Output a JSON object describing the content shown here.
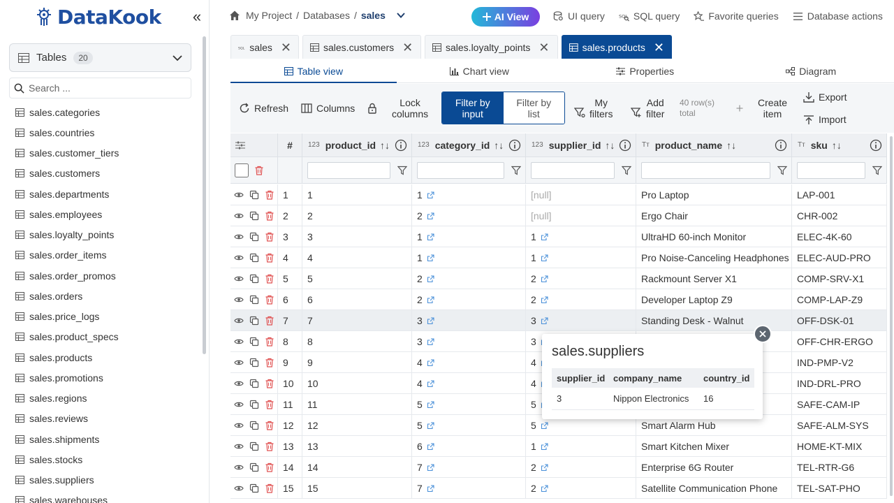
{
  "app": {
    "logo_text": "DataKook",
    "collapse_glyph": "«"
  },
  "sidebar": {
    "tables_label": "Tables",
    "tables_count": "20",
    "search_placeholder": "Search ...",
    "items": [
      "sales.categories",
      "sales.countries",
      "sales.customer_tiers",
      "sales.customers",
      "sales.departments",
      "sales.employees",
      "sales.loyalty_points",
      "sales.order_items",
      "sales.order_promos",
      "sales.orders",
      "sales.price_logs",
      "sales.product_specs",
      "sales.products",
      "sales.promotions",
      "sales.regions",
      "sales.reviews",
      "sales.shipments",
      "sales.stocks",
      "sales.suppliers",
      "sales.warehouses"
    ]
  },
  "breadcrumb": {
    "project": "My Project",
    "sep1": "/",
    "databases": "Databases",
    "sep2": "/",
    "current": "sales"
  },
  "top": {
    "ai_view": "AI View",
    "ui_query": "UI query",
    "sql_query": "SQL query",
    "favorite_queries": "Favorite queries",
    "database_actions": "Database actions"
  },
  "tabs": [
    {
      "label": "sales",
      "icon": "sql-icon"
    },
    {
      "label": "sales.customers",
      "icon": "table-icon"
    },
    {
      "label": "sales.loyalty_points",
      "icon": "table-icon"
    },
    {
      "label": "sales.products",
      "icon": "table-icon"
    }
  ],
  "view_tabs": {
    "table": "Table view",
    "chart": "Chart view",
    "properties": "Properties",
    "diagram": "Diagram"
  },
  "toolbar": {
    "refresh": "Refresh",
    "columns": "Columns",
    "lock_1": "Lock",
    "lock_2": "columns",
    "filter_input_1": "Filter by",
    "filter_input_2": "input",
    "filter_list_1": "Filter by",
    "filter_list_2": "list",
    "my_filters_1": "My",
    "my_filters_2": "filters",
    "add_filter_1": "Add",
    "add_filter_2": "filter",
    "row_count_1": "40 row(s)",
    "row_count_2": "total",
    "create_1": "Create",
    "create_2": "item",
    "export": "Export",
    "import": "Import"
  },
  "grid": {
    "hash_header": "#",
    "columns": [
      {
        "type": "123",
        "name": "product_id",
        "sort": "↑↓"
      },
      {
        "type": "123",
        "name": "category_id",
        "sort": "↑↓"
      },
      {
        "type": "123",
        "name": "supplier_id",
        "sort": "↑↓"
      },
      {
        "type": "Tт",
        "name": "product_name",
        "sort": "↑↓"
      },
      {
        "type": "Tт",
        "name": "sku",
        "sort": "↑↓"
      }
    ],
    "rows": [
      {
        "n": "1",
        "product_id": "1",
        "category_id": "1",
        "supplier_id": "[null]",
        "product_name": "Pro Laptop",
        "sku": "LAP-001"
      },
      {
        "n": "2",
        "product_id": "2",
        "category_id": "2",
        "supplier_id": "[null]",
        "product_name": "Ergo Chair",
        "sku": "CHR-002"
      },
      {
        "n": "3",
        "product_id": "3",
        "category_id": "1",
        "supplier_id": "1",
        "product_name": "UltraHD 60-inch Monitor",
        "sku": "ELEC-4K-60"
      },
      {
        "n": "4",
        "product_id": "4",
        "category_id": "1",
        "supplier_id": "1",
        "product_name": "Pro Noise-Canceling Headphones",
        "sku": "ELEC-AUD-PRO"
      },
      {
        "n": "5",
        "product_id": "5",
        "category_id": "2",
        "supplier_id": "2",
        "product_name": "Rackmount Server X1",
        "sku": "COMP-SRV-X1"
      },
      {
        "n": "6",
        "product_id": "6",
        "category_id": "2",
        "supplier_id": "2",
        "product_name": "Developer Laptop Z9",
        "sku": "COMP-LAP-Z9"
      },
      {
        "n": "7",
        "product_id": "7",
        "category_id": "3",
        "supplier_id": "3",
        "product_name": "Standing Desk - Walnut",
        "sku": "OFF-DSK-01"
      },
      {
        "n": "8",
        "product_id": "8",
        "category_id": "3",
        "supplier_id": "3",
        "product_name": "",
        "sku": "OFF-CHR-ERGO"
      },
      {
        "n": "9",
        "product_id": "9",
        "category_id": "4",
        "supplier_id": "4",
        "product_name": "",
        "sku": "IND-PMP-V2"
      },
      {
        "n": "10",
        "product_id": "10",
        "category_id": "4",
        "supplier_id": "4",
        "product_name": "",
        "sku": "IND-DRL-PRO"
      },
      {
        "n": "11",
        "product_id": "11",
        "category_id": "5",
        "supplier_id": "5",
        "product_name": "",
        "sku": "SAFE-CAM-IP"
      },
      {
        "n": "12",
        "product_id": "12",
        "category_id": "5",
        "supplier_id": "5",
        "product_name": "Smart Alarm Hub",
        "sku": "SAFE-ALM-SYS"
      },
      {
        "n": "13",
        "product_id": "13",
        "category_id": "6",
        "supplier_id": "1",
        "product_name": "Smart Kitchen Mixer",
        "sku": "HOME-KT-MIX"
      },
      {
        "n": "14",
        "product_id": "14",
        "category_id": "7",
        "supplier_id": "2",
        "product_name": "Enterprise 6G Router",
        "sku": "TEL-RTR-G6"
      },
      {
        "n": "15",
        "product_id": "15",
        "category_id": "7",
        "supplier_id": "2",
        "product_name": "Satellite Communication Phone",
        "sku": "TEL-SAT-PHO"
      }
    ]
  },
  "popover": {
    "title": "sales.suppliers",
    "headers": [
      "supplier_id",
      "company_name",
      "country_id"
    ],
    "row": [
      "3",
      "Nippon Electronics",
      "16"
    ]
  },
  "colors": {
    "brand": "#1f4fa0",
    "accent": "#0a4a94",
    "delete": "#e05252"
  }
}
